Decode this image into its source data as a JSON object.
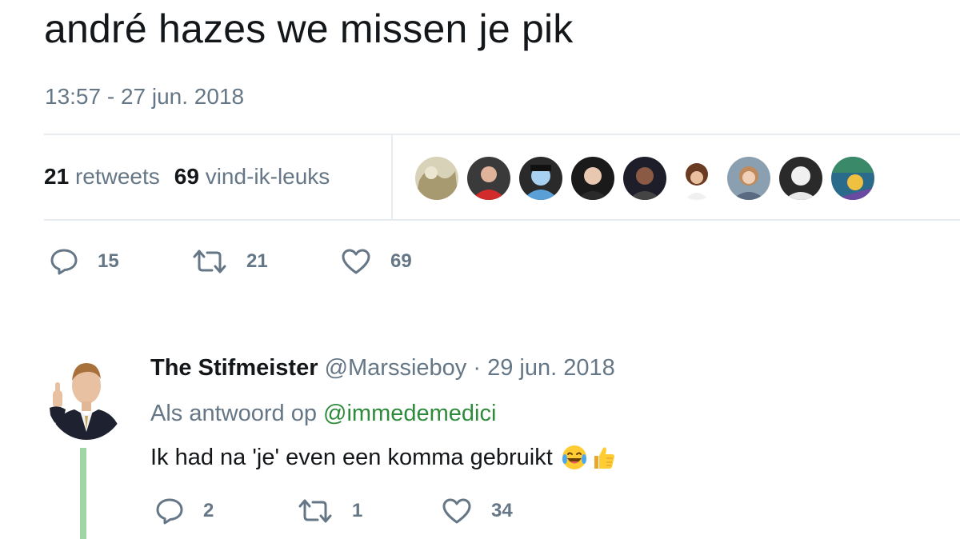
{
  "tweet": {
    "text": "andré hazes we missen je pik",
    "timestamp": "13:57 - 27 jun. 2018",
    "retweets_count": "21",
    "retweets_label": "retweets",
    "likes_count": "69",
    "likes_label": "vind-ik-leuks",
    "actions": {
      "replies": "15",
      "retweets": "21",
      "likes": "69"
    },
    "liker_avatars": [
      {
        "color": "#c9c4a8"
      },
      {
        "color": "#d12b2b"
      },
      {
        "color": "#5aa0d8"
      },
      {
        "color": "#2a2a2a"
      },
      {
        "color": "#1e1e2a"
      },
      {
        "color": "#8a5a3a"
      },
      {
        "color": "#c8a68a"
      },
      {
        "color": "#e8e8e8"
      },
      {
        "color": "#3a8a6a"
      }
    ]
  },
  "reply": {
    "display_name": "The Stifmeister",
    "handle": "@Marssieboy",
    "separator": "·",
    "date": "29 jun. 2018",
    "reply_to_label": "Als antwoord op",
    "reply_to_mention": "@immedemedici",
    "text": "Ik had na 'je' even een komma gebruikt",
    "emojis": [
      "face-with-tears-of-joy-icon",
      "thumbs-up-icon"
    ],
    "actions": {
      "replies": "2",
      "retweets": "1",
      "likes": "34"
    }
  },
  "colors": {
    "text_primary": "#14171a",
    "text_secondary": "#657786",
    "divider": "#e6ecf0",
    "mention": "#2e8b3c",
    "thread_line": "#9fd4a4"
  }
}
